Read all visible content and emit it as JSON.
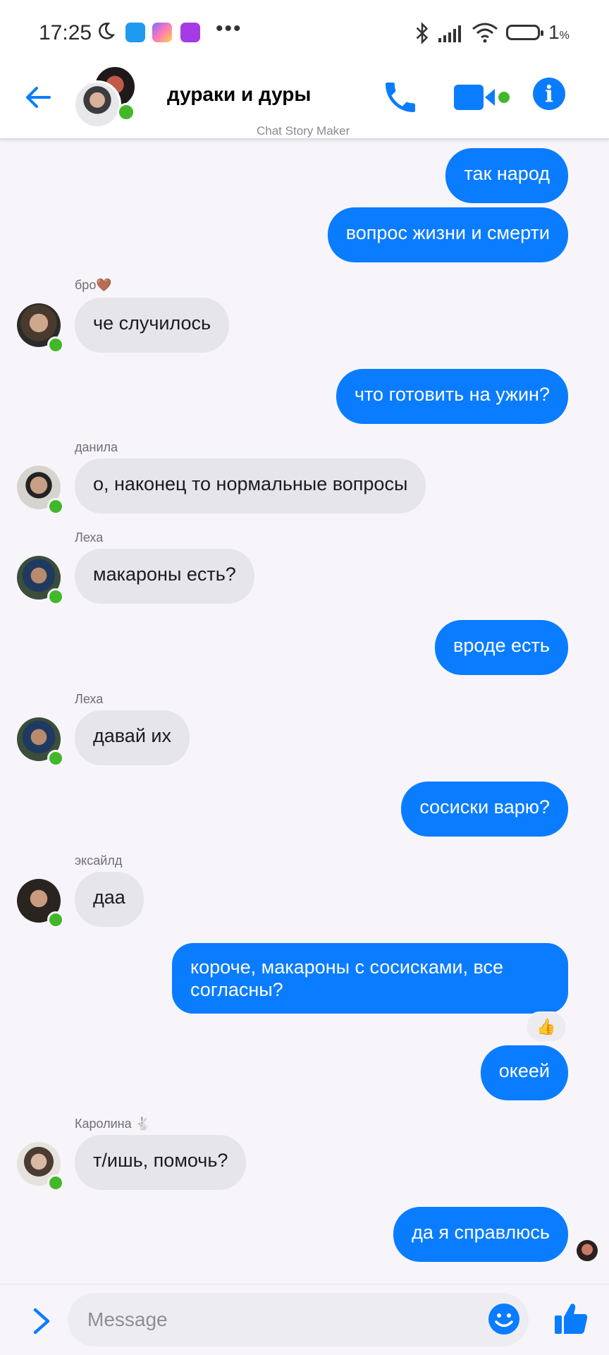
{
  "status_bar": {
    "time": "17:25",
    "battery_text": "1",
    "battery_unit": "%"
  },
  "header": {
    "title": "дураки и дуры",
    "subtitle": "Chat Story Maker",
    "accent_color": "#0a7cff",
    "online_color": "#42b72a"
  },
  "messages": [
    {
      "side": "out",
      "text": "так народ"
    },
    {
      "side": "out",
      "text": "вопрос жизни и смерти"
    },
    {
      "side": "in",
      "sender": "бро🤎",
      "text": "че случилось"
    },
    {
      "side": "out",
      "text": "что готовить на ужин?"
    },
    {
      "side": "in",
      "sender": "данила",
      "text": "о, наконец то нормальные вопросы"
    },
    {
      "side": "in",
      "sender": "Леха",
      "text": "макароны есть?"
    },
    {
      "side": "out",
      "text": "вроде есть"
    },
    {
      "side": "in",
      "sender": "Леха",
      "text": "давай их"
    },
    {
      "side": "out",
      "text": "сосиски варю?"
    },
    {
      "side": "in",
      "sender": "эксайлд",
      "text": "даа"
    },
    {
      "side": "out",
      "text": "короче, макароны с сосисками, все согласны?",
      "reaction": "👍"
    },
    {
      "side": "out",
      "text": "океей"
    },
    {
      "side": "in",
      "sender": "Каролина 🐇",
      "text": "т/ишь, помочь?"
    },
    {
      "side": "out",
      "text": "да я справлюсь"
    }
  ],
  "composer": {
    "placeholder": "Message"
  },
  "icons": {
    "back": "arrow-left-icon",
    "call": "phone-icon",
    "video": "video-camera-icon",
    "info": "info-icon",
    "expand": "chevron-right-icon",
    "emoji": "smiley-icon",
    "like": "thumbs-up-icon"
  }
}
